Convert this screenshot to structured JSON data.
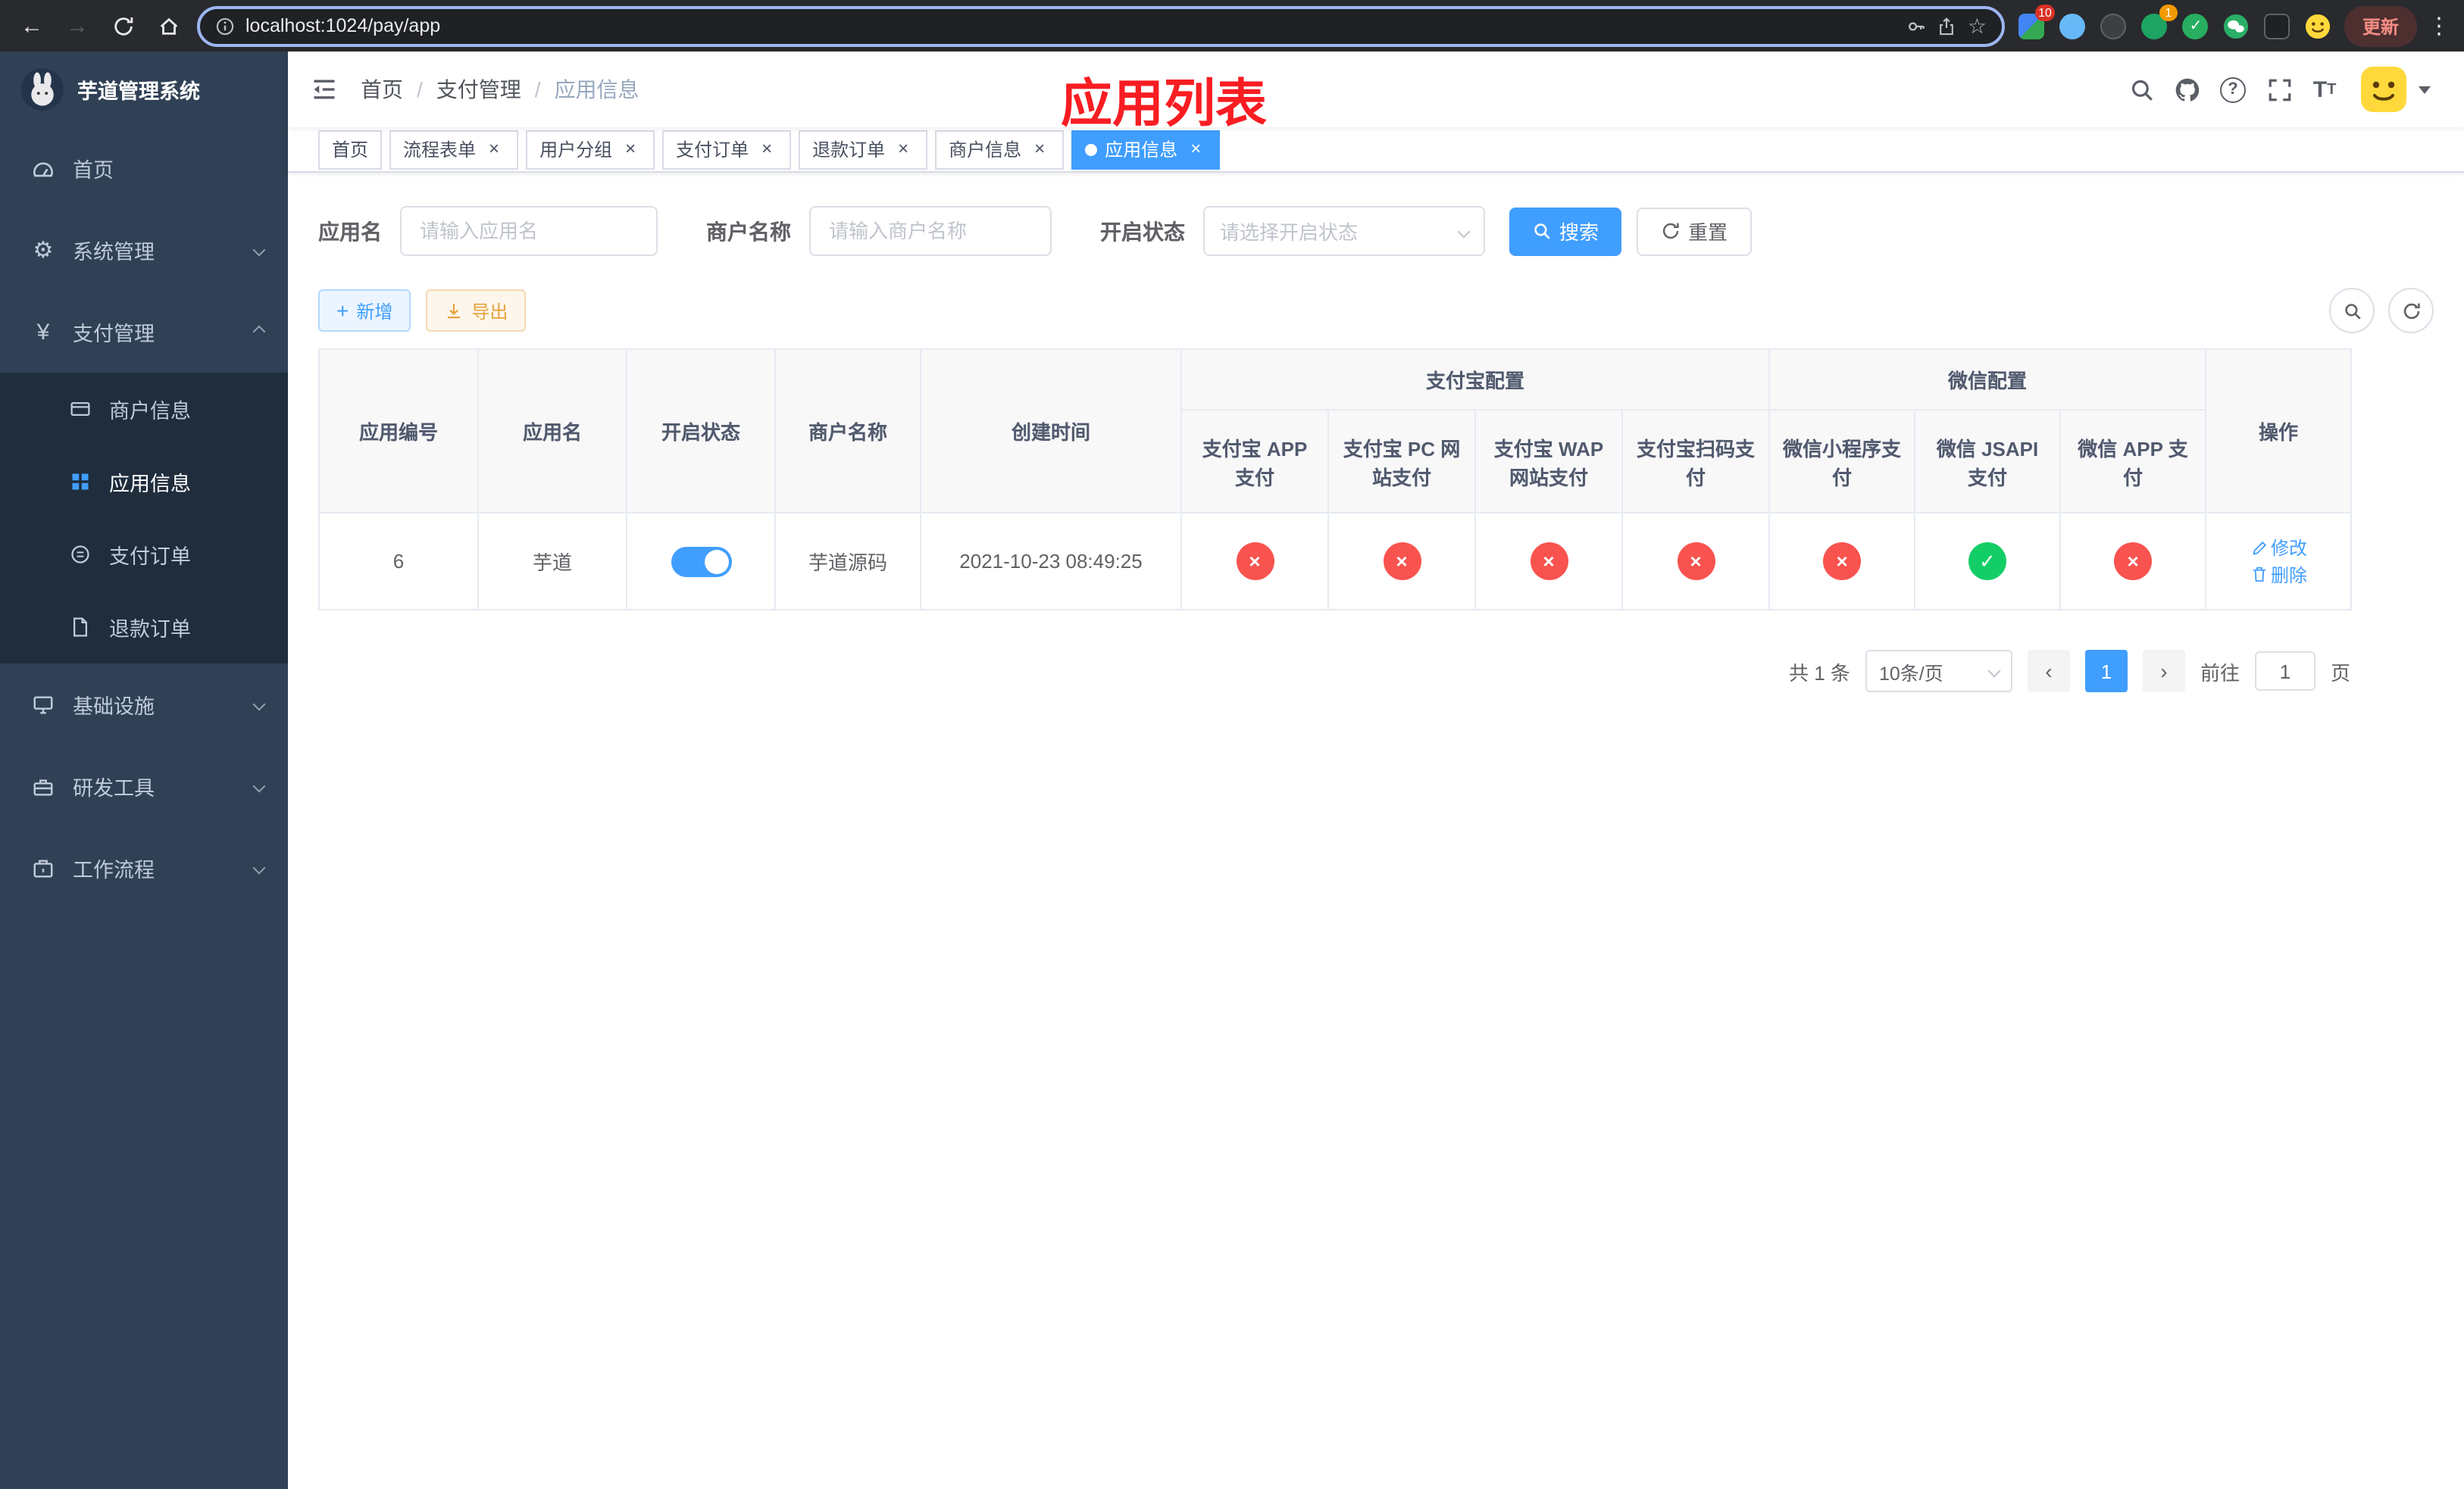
{
  "browser": {
    "url": "localhost:1024/pay/app",
    "update_label": "更新",
    "ext_badge": "10",
    "avatar_badge": "1"
  },
  "sidebar": {
    "title": "芋道管理系统",
    "items": [
      {
        "label": "首页"
      },
      {
        "label": "系统管理"
      },
      {
        "label": "支付管理"
      },
      {
        "label": "基础设施"
      },
      {
        "label": "研发工具"
      },
      {
        "label": "工作流程"
      }
    ],
    "sub_items": [
      {
        "label": "商户信息"
      },
      {
        "label": "应用信息"
      },
      {
        "label": "支付订单"
      },
      {
        "label": "退款订单"
      }
    ]
  },
  "header": {
    "breadcrumb": [
      "首页",
      "支付管理",
      "应用信息"
    ],
    "annotation": "应用列表"
  },
  "tabs": [
    {
      "label": "首页",
      "closable": false,
      "active": false
    },
    {
      "label": "流程表单",
      "closable": true,
      "active": false
    },
    {
      "label": "用户分组",
      "closable": true,
      "active": false
    },
    {
      "label": "支付订单",
      "closable": true,
      "active": false
    },
    {
      "label": "退款订单",
      "closable": true,
      "active": false
    },
    {
      "label": "商户信息",
      "closable": true,
      "active": false
    },
    {
      "label": "应用信息",
      "closable": true,
      "active": true
    }
  ],
  "filters": {
    "app_name": {
      "label": "应用名",
      "placeholder": "请输入应用名",
      "value": ""
    },
    "merchant_name": {
      "label": "商户名称",
      "placeholder": "请输入商户名称",
      "value": ""
    },
    "status": {
      "label": "开启状态",
      "placeholder": "请选择开启状态"
    },
    "search": "搜索",
    "reset": "重置"
  },
  "toolbar": {
    "add": "新增",
    "export": "导出"
  },
  "table": {
    "columns": {
      "app_id": "应用编号",
      "app_name": "应用名",
      "status": "开启状态",
      "merchant": "商户名称",
      "created": "创建时间",
      "alipay_group": "支付宝配置",
      "wechat_group": "微信配置",
      "actions": "操作",
      "alipay_app": "支付宝 APP 支付",
      "alipay_pc": "支付宝 PC 网站支付",
      "alipay_wap": "支付宝 WAP 网站支付",
      "alipay_qr": "支付宝扫码支付",
      "wechat_mini": "微信小程序支付",
      "wechat_jsapi": "微信 JSAPI 支付",
      "wechat_app": "微信 APP 支付"
    },
    "rows": [
      {
        "app_id": "6",
        "app_name": "芋道",
        "status_on": true,
        "merchant": "芋道源码",
        "created": "2021-10-23 08:49:25",
        "alipay_app": false,
        "alipay_pc": false,
        "alipay_wap": false,
        "alipay_qr": false,
        "wechat_mini": false,
        "wechat_jsapi": true,
        "wechat_app": false,
        "edit_label": "修改",
        "delete_label": "删除"
      }
    ]
  },
  "pagination": {
    "total": "共 1 条",
    "page_size": "10条/页",
    "page": "1",
    "goto_prefix": "前往",
    "goto_value": "1",
    "goto_suffix": "页"
  },
  "icons": {
    "back": "←",
    "forward": "→",
    "star": "☆",
    "kebab": "⋮",
    "question": "?",
    "gear": "⚙",
    "yen": "¥",
    "plus": "+",
    "close": "×",
    "cross": "×",
    "check": "✓",
    "separator": "/",
    "prev": "‹",
    "next": "›",
    "font_large": "T",
    "font_small": "T"
  },
  "colors": {
    "accent": "#409eff",
    "danger": "#f9534f",
    "success": "#13ce66",
    "warning": "#e6a23c",
    "sidebar_bg": "#304156",
    "submenu_bg": "#1f2d3d",
    "annotation": "#f81d22"
  }
}
